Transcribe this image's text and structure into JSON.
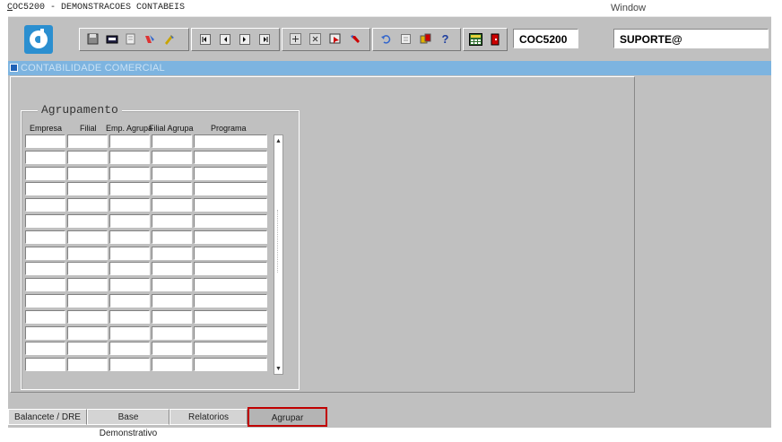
{
  "window": {
    "title_prefix": "C",
    "title_rest": "OC5200 - DEMONSTRACOES CONTABEIS",
    "menu_window": "Window"
  },
  "toolbar": {
    "program_code": "COC5200",
    "user": "SUPORTE@",
    "icons": [
      "save",
      "print",
      "print-preview",
      "clear-field",
      "clear-block",
      "first-record",
      "previous-record",
      "next-record",
      "last-record",
      "insert-record",
      "delete-record",
      "duplicate-record",
      "lock-record",
      "undo",
      "list",
      "attach",
      "help",
      "calculator",
      "exit"
    ]
  },
  "form": {
    "title": "CONTABILIDADE COMERCIAL"
  },
  "group": {
    "title": "Agrupamento",
    "columns": [
      "Empresa",
      "Filial",
      "Emp. Agrupa",
      "Filial Agrupa",
      "Programa"
    ],
    "row_count": 15
  },
  "tabs": [
    {
      "label": "Balancete / DRE",
      "active": false
    },
    {
      "label": "Base Demonstrativo",
      "active": false
    },
    {
      "label": "Relatorios",
      "active": false
    },
    {
      "label": "Agrupar",
      "active": true
    }
  ],
  "colors": {
    "highlight": "#c00000",
    "titlebar": "#7db4e0",
    "logo": "#2b8fd0"
  }
}
